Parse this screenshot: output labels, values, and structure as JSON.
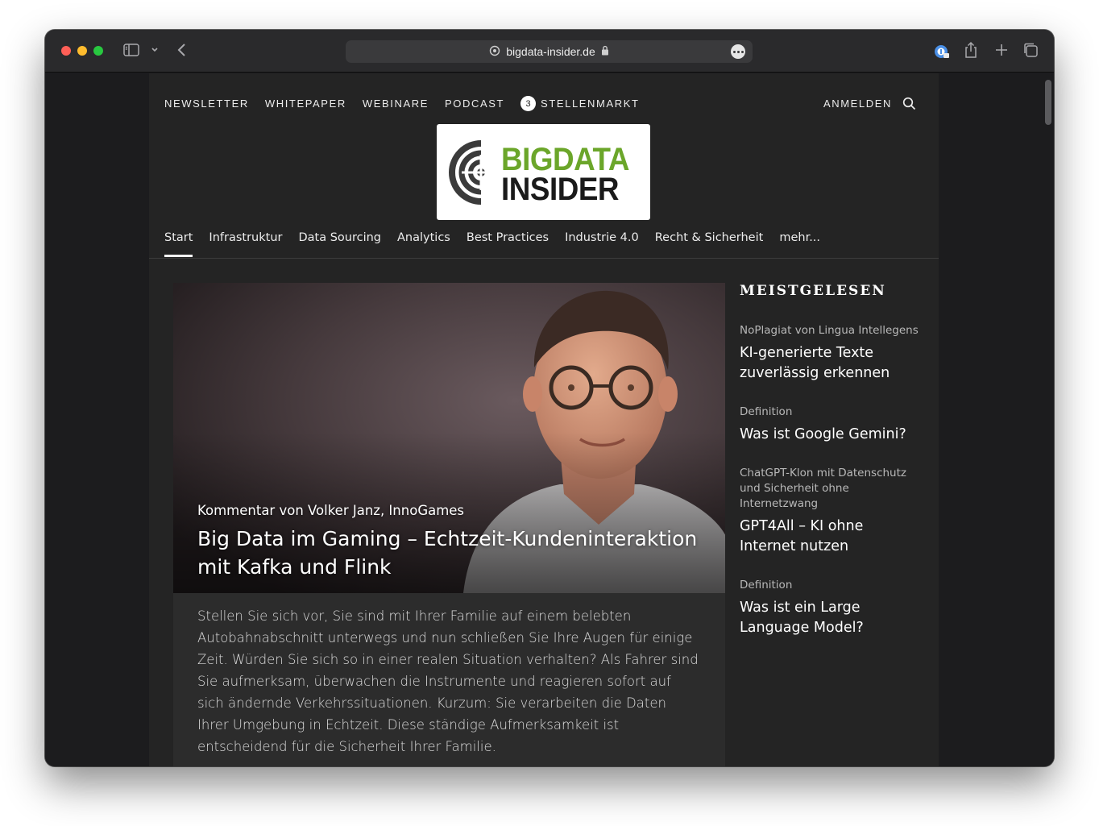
{
  "browser": {
    "url": "bigdata-insider.de"
  },
  "site": {
    "topnav": [
      "NEWSLETTER",
      "WHITEPAPER",
      "WEBINARE",
      "PODCAST"
    ],
    "jobs_badge": "3",
    "jobs_label": "STELLENMARKT",
    "login_label": "ANMELDEN",
    "logo": {
      "line1": "BIGDATA",
      "line2": "INSIDER",
      "color_line1": "#6ba62a"
    },
    "mainnav": [
      "Start",
      "Infrastruktur",
      "Data Sourcing",
      "Analytics",
      "Best Practices",
      "Industrie 4.0",
      "Recht & Sicherheit",
      "mehr..."
    ],
    "active_nav": "Start"
  },
  "hero": {
    "kicker": "Kommentar von Volker Janz, InnoGames",
    "title": "Big Data im Gaming – Echtzeit-Kundeninteraktion mit Kafka und Flink",
    "teaser": "Stellen Sie sich vor, Sie sind mit Ihrer Familie auf einem belebten Autobahnabschnitt unterwegs und nun schließen Sie Ihre Augen für einige Zeit. Würden Sie sich so in einer realen Situation verhalten? Als Fahrer sind Sie aufmerksam, überwachen die Instrumente und reagieren sofort auf sich ändernde Verkehrssituationen. Kurzum: Sie verarbeiten die Daten Ihrer Umgebung in Echtzeit. Diese ständige Aufmerksamkeit ist entscheidend für die Sicherheit Ihrer Familie."
  },
  "sidebar": {
    "heading": "MEISTGELESEN",
    "items": [
      {
        "kicker": "NoPlagiat von Lingua Intellegens",
        "title": "KI-generierte Texte zuverlässig erkennen"
      },
      {
        "kicker": "Definition",
        "title": "Was ist Google Gemini?"
      },
      {
        "kicker": "ChatGPT-Klon mit Datenschutz und Sicherheit ohne Internetzwang",
        "title": "GPT4All – KI ohne Internet nutzen"
      },
      {
        "kicker": "Definition",
        "title": "Was ist ein Large Language Model?"
      }
    ]
  }
}
